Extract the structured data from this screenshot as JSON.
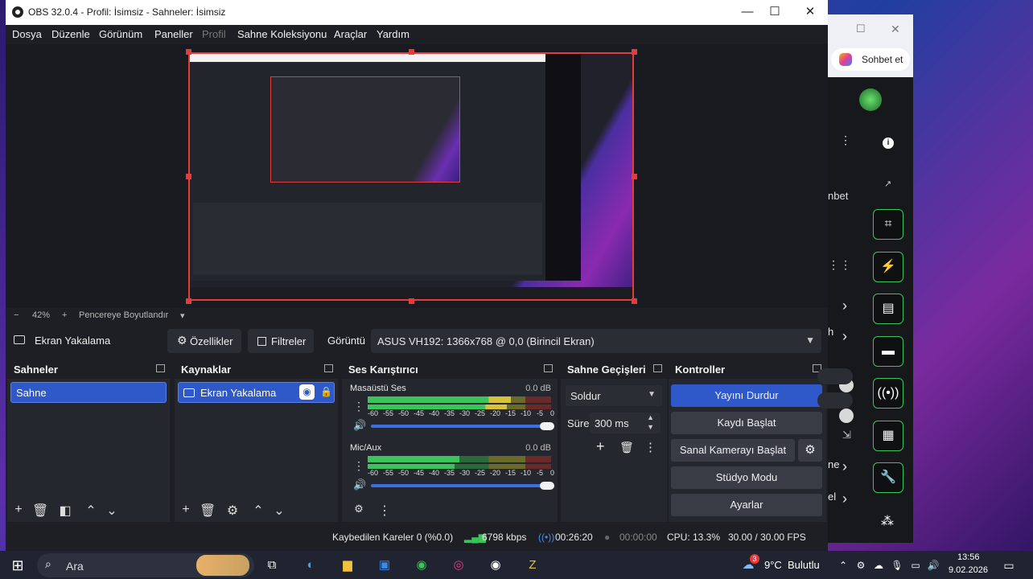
{
  "window": {
    "title": "OBS 32.0.4 - Profil: İsimsiz - Sahneler: İsimsiz",
    "minimize": "—",
    "maximize": "☐",
    "close": "✕"
  },
  "menu": [
    "Dosya",
    "Düzenle",
    "Görünüm",
    "Paneller",
    "Profil",
    "Sahne Koleksiyonu",
    "Araçlar",
    "Yardım"
  ],
  "zoom": {
    "minus": "−",
    "value": "42%",
    "plus": "+",
    "fit_label": "Pencereye Boyutlandır",
    "arrow": "▾"
  },
  "source_bar": {
    "source_name": "Ekran Yakalama",
    "properties": "Özellikler",
    "filters": "Filtreler",
    "display_label": "Görüntü",
    "display_value": "ASUS VH192: 1366x768 @ 0,0 (Birincil Ekran)"
  },
  "scenes": {
    "title": "Sahneler",
    "items": [
      "Sahne"
    ]
  },
  "sources": {
    "title": "Kaynaklar",
    "items": [
      "Ekran Yakalama"
    ]
  },
  "mixer": {
    "title": "Ses Karıştırıcı",
    "channels": [
      {
        "name": "Masaüstü Ses",
        "db": "0.0 dB",
        "level": 0.78
      },
      {
        "name": "Mic/Aux",
        "db": "0.0 dB",
        "level": 0.5
      }
    ],
    "ticks": [
      "-60",
      "-55",
      "-50",
      "-45",
      "-40",
      "-35",
      "-30",
      "-25",
      "-20",
      "-15",
      "-10",
      "-5",
      "0"
    ]
  },
  "transitions": {
    "title": "Sahne Geçişleri",
    "selected": "Soldur",
    "duration_label": "Süre",
    "duration_value": "300 ms"
  },
  "controls": {
    "title": "Kontroller",
    "buttons": [
      "Yayını Durdur",
      "Kaydı Başlat",
      "Sanal Kamerayı Başlat",
      "Stüdyo Modu",
      "Ayarlar"
    ]
  },
  "status": {
    "dropped": "Kaybedilen Kareler 0 (%0.0)",
    "bitrate": "6798 kbps",
    "stream_time": "00:26:20",
    "rec_time": "00:00:00",
    "cpu": "CPU: 13.3%",
    "fps": "30.00 / 30.00 FPS"
  },
  "right_app": {
    "chat_label": "Sohbet et",
    "partial_text": "nbet",
    "partial_h": "h",
    "partial_ne": "ne",
    "partial_el": "el"
  },
  "taskbar": {
    "search_placeholder": "Ara",
    "weather_temp": "9°C",
    "weather_desc": "Bulutlu",
    "weather_badge": "3",
    "time": "13:56",
    "date": "9.02.2026"
  },
  "colors": {
    "accent": "#2f58c8",
    "selection_red": "#e53b3b",
    "meter_green": "#3ac45a",
    "meter_yellow": "#d8c23a",
    "meter_red": "#c8333f"
  }
}
